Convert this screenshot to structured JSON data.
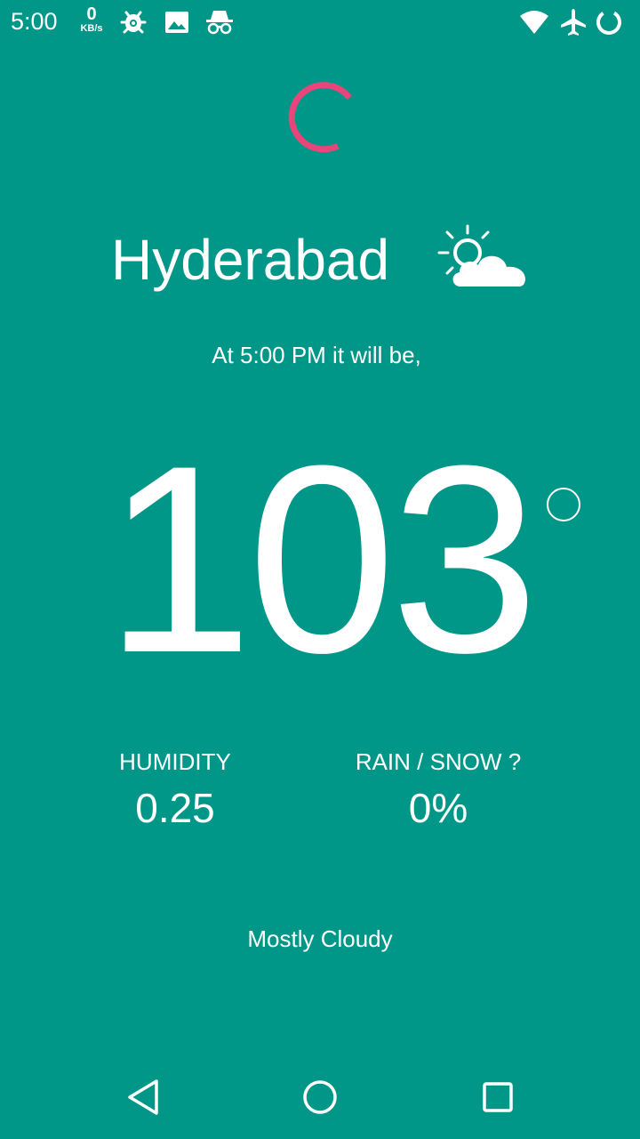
{
  "status_bar": {
    "time": "5:00",
    "net_speed_value": "0",
    "net_speed_unit": "KB/s",
    "icons": [
      "bug-icon",
      "image-icon",
      "incognito-icon",
      "wifi-icon",
      "airplane-icon",
      "sync-icon"
    ]
  },
  "weather": {
    "city": "Hyderabad",
    "icon": "partly-cloudy-icon",
    "forecast_time": "At 5:00 PM it will be,",
    "temperature": "103",
    "humidity_label": "HUMIDITY",
    "humidity_value": "0.25",
    "precip_label": "RAIN / SNOW ?",
    "precip_value": "0%",
    "summary": "Mostly Cloudy"
  },
  "navigation": {
    "icons": [
      "back-icon",
      "home-icon",
      "recents-icon"
    ]
  },
  "colors": {
    "background": "#009688",
    "spinner": "#e8457a",
    "text": "#ffffff"
  }
}
